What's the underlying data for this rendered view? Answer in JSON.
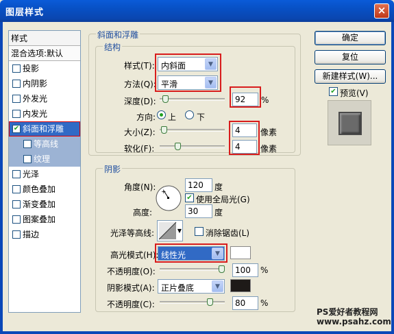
{
  "window": {
    "title": "图层样式",
    "close_glyph": "×"
  },
  "style_list": {
    "header": "样式",
    "blend": "混合选项:默认",
    "items": [
      {
        "label": "投影",
        "checked": false
      },
      {
        "label": "内阴影",
        "checked": false
      },
      {
        "label": "外发光",
        "checked": false
      },
      {
        "label": "内发光",
        "checked": false
      },
      {
        "label": "斜面和浮雕",
        "checked": true,
        "selected": true
      },
      {
        "label": "等高线",
        "checked": false,
        "sub": true
      },
      {
        "label": "纹理",
        "checked": false,
        "sub": true
      },
      {
        "label": "光泽",
        "checked": false
      },
      {
        "label": "颜色叠加",
        "checked": false
      },
      {
        "label": "渐变叠加",
        "checked": false
      },
      {
        "label": "图案叠加",
        "checked": false
      },
      {
        "label": "描边",
        "checked": false
      }
    ]
  },
  "bevel": {
    "section_title": "斜面和浮雕",
    "structure_title": "结构",
    "style_label": "样式(T):",
    "style_value": "内斜面",
    "method_label": "方法(Q):",
    "method_value": "平滑",
    "depth_label": "深度(D):",
    "depth_value": "92",
    "depth_unit": "%",
    "depth_level_pct": 5,
    "direction_label": "方向:",
    "direction_up": "上",
    "direction_down": "下",
    "direction_selected": "上",
    "size_label": "大小(Z):",
    "size_value": "4",
    "size_unit": "像素",
    "size_level_pct": 2,
    "soften_label": "软化(F):",
    "soften_value": "4",
    "soften_unit": "像素",
    "soften_level_pct": 25
  },
  "shading": {
    "title": "阴影",
    "angle_label": "角度(N):",
    "angle_value": "120",
    "angle_unit": "度",
    "global_light_label": "使用全局光(G)",
    "global_light_checked": true,
    "altitude_label": "高度:",
    "altitude_value": "30",
    "altitude_unit": "度",
    "gloss_label": "光泽等高线:",
    "antialias_label": "消除锯齿(L)",
    "antialias_checked": false,
    "highlight_label": "高光模式(H):",
    "highlight_value": "线性光",
    "highlight_color": "#ffffff",
    "highlight_opacity_label": "不透明度(O):",
    "highlight_opacity_value": "100",
    "highlight_opacity_pct": 100,
    "shadow_label": "阴影模式(A):",
    "shadow_value": "正片叠底",
    "shadow_color": "#1e1a18",
    "shadow_opacity_label": "不透明度(C):",
    "shadow_opacity_value": "80",
    "shadow_opacity_pct": 80,
    "percent": "%"
  },
  "buttons": {
    "ok": "确定",
    "reset": "复位",
    "new_style": "新建样式(W)...",
    "preview_label": "预览(V)",
    "preview_checked": true
  },
  "watermark": {
    "line1": "PS爱好者教程网",
    "line2": "www.psahz.com"
  }
}
